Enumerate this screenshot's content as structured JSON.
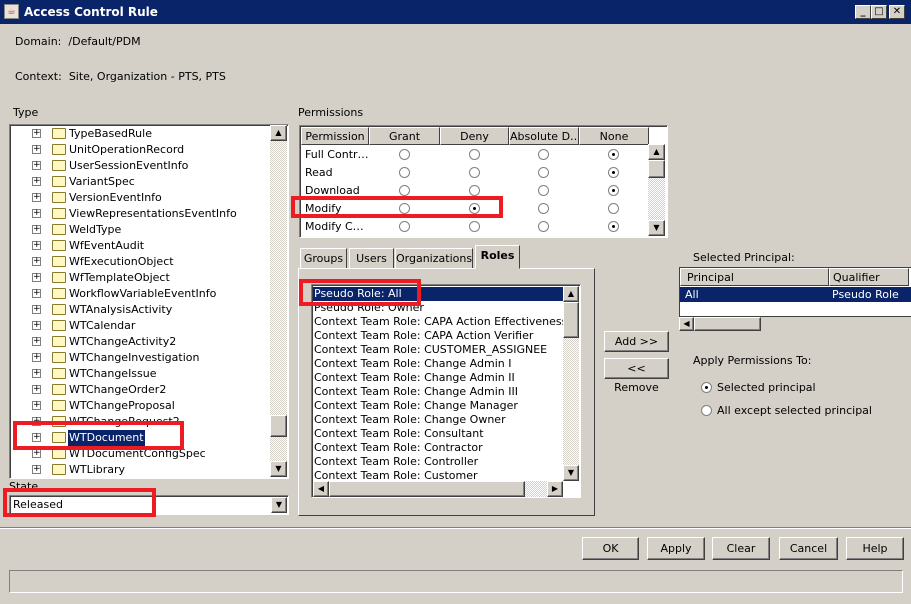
{
  "window": {
    "title": "Access Control Rule",
    "controls": [
      "minimize",
      "maximize",
      "close"
    ]
  },
  "domain": {
    "label": "Domain:",
    "value": "/Default/PDM"
  },
  "context": {
    "label": "Context:",
    "value": "Site, Organization - PTS, PTS"
  },
  "type": {
    "label": "Type",
    "items": [
      "TypeBasedRule",
      "UnitOperationRecord",
      "UserSessionEventInfo",
      "VariantSpec",
      "VersionEventInfo",
      "ViewRepresentationsEventInfo",
      "WeldType",
      "WfEventAudit",
      "WfExecutionObject",
      "WfTemplateObject",
      "WorkflowVariableEventInfo",
      "WTAnalysisActivity",
      "WTCalendar",
      "WTChangeActivity2",
      "WTChangeInvestigation",
      "WTChangeIssue",
      "WTChangeOrder2",
      "WTChangeProposal",
      "WTChangeRequest2",
      "WTDocument",
      "WTDocumentConfigSpec",
      "WTLibrary"
    ],
    "selected": "WTDocument"
  },
  "state": {
    "label": "State",
    "value": "Released"
  },
  "permissions": {
    "label": "Permissions",
    "columns": [
      "Permission",
      "Grant",
      "Deny",
      "Absolute D…",
      "None"
    ],
    "rows": [
      {
        "name": "Full Contr…",
        "value": "None"
      },
      {
        "name": "Read",
        "value": "None"
      },
      {
        "name": "Download",
        "value": "None"
      },
      {
        "name": "Modify",
        "value": "Deny"
      },
      {
        "name": "Modify C…",
        "value": "None"
      }
    ]
  },
  "tabs": {
    "items": [
      "Groups",
      "Users",
      "Organizations",
      "Roles"
    ],
    "active": "Roles"
  },
  "roles": {
    "items": [
      "Pseudo Role: All",
      "Pseudo Role: Owner",
      "Context Team Role: CAPA Action Effectiveness Approver",
      "Context Team Role: CAPA Action Verifier",
      "Context Team Role: CUSTOMER_ASSIGNEE",
      "Context Team Role: Change Admin I",
      "Context Team Role: Change Admin II",
      "Context Team Role: Change Admin III",
      "Context Team Role: Change Manager",
      "Context Team Role: Change Owner",
      "Context Team Role: Consultant",
      "Context Team Role: Contractor",
      "Context Team Role: Controller",
      "Context Team Role: Customer"
    ],
    "selected": "Pseudo Role: All"
  },
  "add_button": "Add >>",
  "remove_button": "<< Remove",
  "selected_principal": {
    "label": "Selected Principal:",
    "columns": [
      "Principal",
      "Qualifier"
    ],
    "rows": [
      {
        "principal": "All",
        "qualifier": "Pseudo Role"
      }
    ]
  },
  "apply_to": {
    "label": "Apply Permissions To:",
    "options": [
      "Selected principal",
      "All except selected principal"
    ],
    "selected": "Selected principal"
  },
  "buttons": {
    "ok": "OK",
    "apply": "Apply",
    "clear": "Clear",
    "cancel": "Cancel",
    "help": "Help"
  },
  "highlight_color": "#ed1c24",
  "selection_color": "#0a246a"
}
